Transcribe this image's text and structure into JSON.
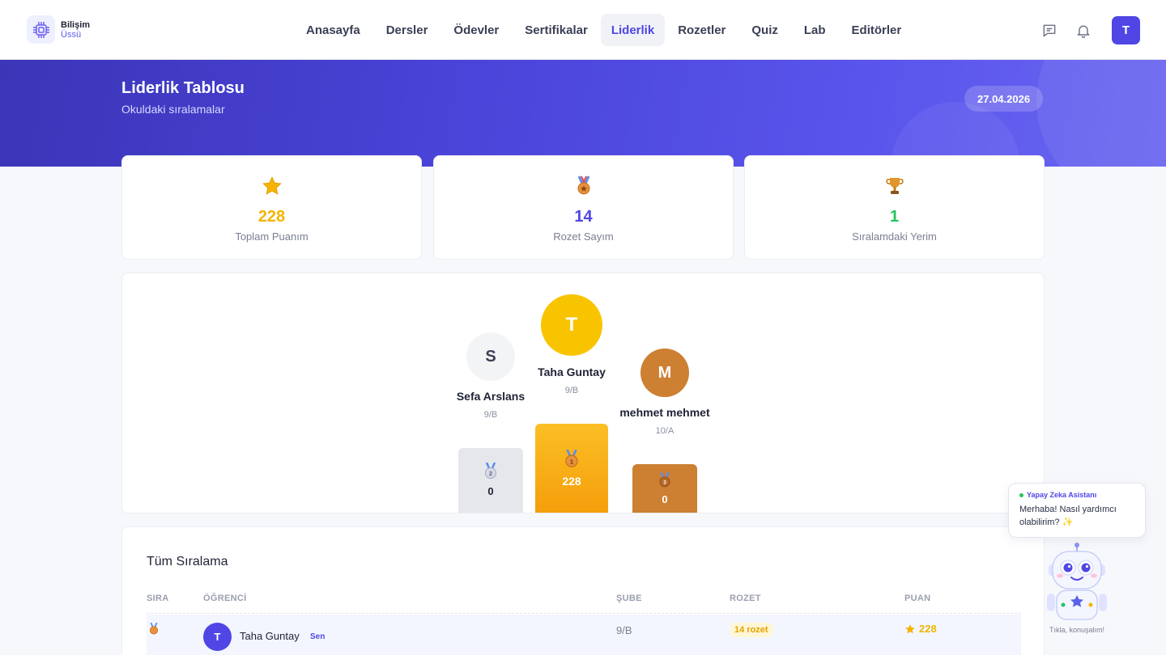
{
  "logo": {
    "line1": "Bilişim",
    "line2": "Üssü"
  },
  "nav": {
    "items": [
      {
        "label": "Anasayfa"
      },
      {
        "label": "Dersler"
      },
      {
        "label": "Ödevler"
      },
      {
        "label": "Sertifikalar"
      },
      {
        "label": "Liderlik",
        "active": true
      },
      {
        "label": "Rozetler"
      },
      {
        "label": "Quiz"
      },
      {
        "label": "Lab"
      },
      {
        "label": "Editörler"
      }
    ],
    "avatar_initial": "T"
  },
  "hero": {
    "title": "Liderlik Tablosu",
    "subtitle": "Okuldaki sıralamalar",
    "date": "27.04.2026"
  },
  "stats": [
    {
      "value": "228",
      "label": "Toplam Puanım",
      "icon": "star-icon",
      "color": "#f5b400"
    },
    {
      "value": "14",
      "label": "Rozet Sayım",
      "icon": "medal-icon",
      "color": "#4f46e5"
    },
    {
      "value": "1",
      "label": "Sıralamdaki Yerim",
      "icon": "trophy-icon",
      "color": "#22c55e"
    }
  ],
  "podium": {
    "first": {
      "initial": "T",
      "name": "Taha Guntay",
      "class": "9/B",
      "score": "228",
      "rank": "1"
    },
    "second": {
      "initial": "S",
      "name": "Sefa Arslans",
      "class": "9/B",
      "score": "0",
      "rank": "2"
    },
    "third": {
      "initial": "M",
      "name": "mehmet mehmet",
      "class": "10/A",
      "score": "0",
      "rank": "3"
    }
  },
  "ranking": {
    "title": "Tüm Sıralama",
    "headers": {
      "sira": "SIRA",
      "ogrenci": "ÖĞRENCİ",
      "sube": "ŞUBE",
      "rozet": "ROZET",
      "puan": "PUAN"
    },
    "rows": [
      {
        "initial": "T",
        "name": "Taha Guntay",
        "tag": "Sen",
        "sube": "9/B",
        "rozet": "14 rozet",
        "puan": "228"
      }
    ]
  },
  "assistant": {
    "title": "Yapay Zeka Asistanı",
    "message": "Merhaba! Nasıl yardımcı olabilirim? ✨",
    "caption": "Tıkla, konuşalım!"
  },
  "colors": {
    "accent": "#4f46e5",
    "gold": "#f5b400",
    "bronze": "#cd7f32",
    "silver": "#e5e7eb"
  }
}
